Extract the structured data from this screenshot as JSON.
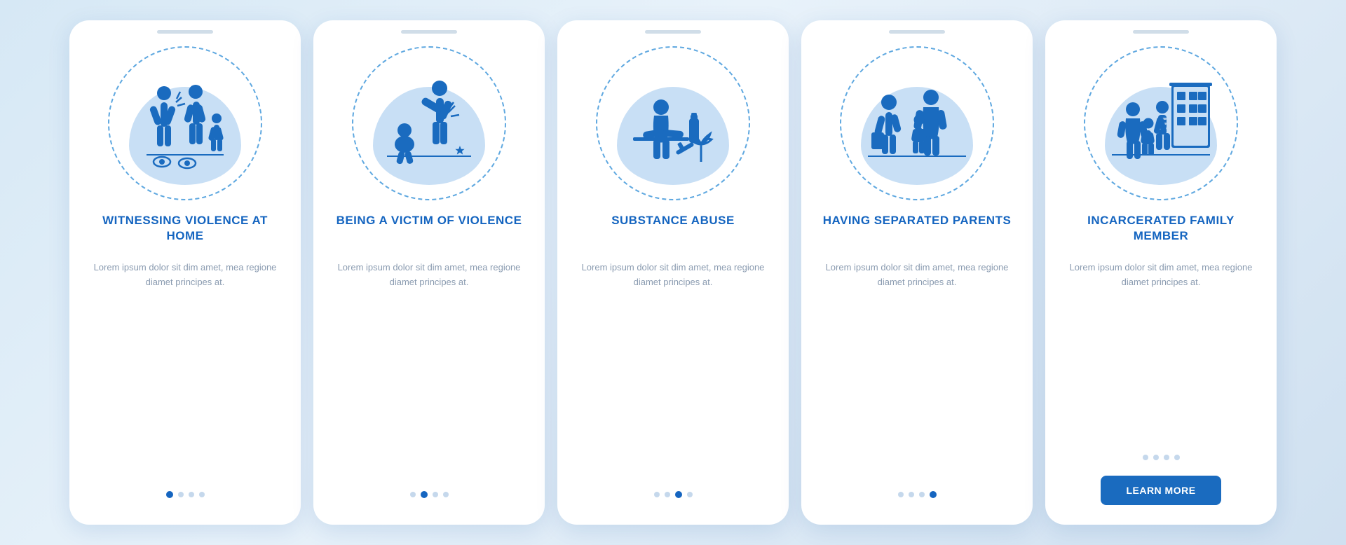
{
  "cards": [
    {
      "id": "card-1",
      "title": "WITNESSING\nVIOLENCE AT HOME",
      "body": "Lorem ipsum dolor sit dim amet, mea regione diamet principes at.",
      "dots": [
        true,
        false,
        false,
        false
      ],
      "active_dot": 0,
      "show_button": false,
      "button_label": ""
    },
    {
      "id": "card-2",
      "title": "BEING A VICTIM\nOF VIOLENCE",
      "body": "Lorem ipsum dolor sit dim amet, mea regione diamet principes at.",
      "dots": [
        false,
        true,
        false,
        false
      ],
      "active_dot": 1,
      "show_button": false,
      "button_label": ""
    },
    {
      "id": "card-3",
      "title": "SUBSTANCE\nABUSE",
      "body": "Lorem ipsum dolor sit dim amet, mea regione diamet principes at.",
      "dots": [
        false,
        false,
        true,
        false
      ],
      "active_dot": 2,
      "show_button": false,
      "button_label": ""
    },
    {
      "id": "card-4",
      "title": "HAVING SEPARATED\nPARENTS",
      "body": "Lorem ipsum dolor sit dim amet, mea regione diamet principes at.",
      "dots": [
        false,
        false,
        false,
        true
      ],
      "active_dot": 3,
      "show_button": false,
      "button_label": ""
    },
    {
      "id": "card-5",
      "title": "INCARCERATED\nFAMILY MEMBER",
      "body": "Lorem ipsum dolor sit dim amet, mea regione diamet principes at.",
      "dots": [
        false,
        false,
        false,
        false
      ],
      "active_dot": -1,
      "show_button": true,
      "button_label": "LEARN MORE"
    }
  ]
}
